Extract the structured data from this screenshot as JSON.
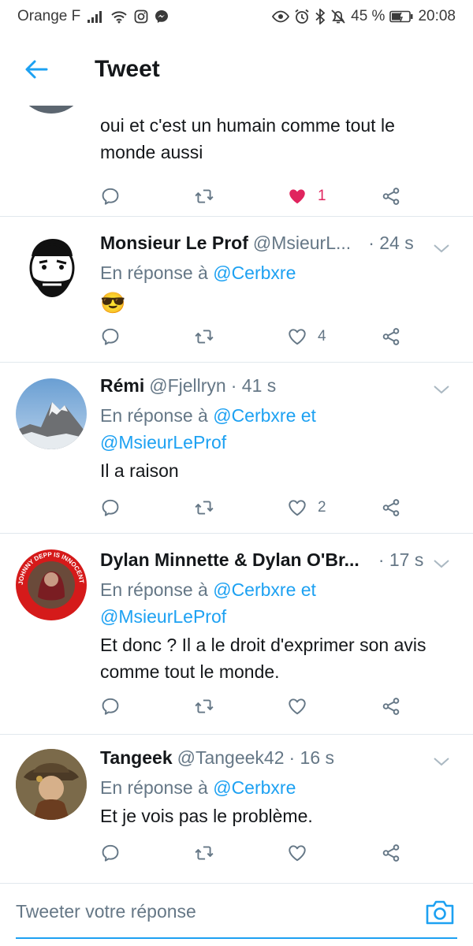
{
  "status_bar": {
    "carrier": "Orange F",
    "battery": "45 %",
    "time": "20:08"
  },
  "header": {
    "title": "Tweet"
  },
  "tweets": [
    {
      "text_line1": "oui et c'est un humain comme tout le",
      "text_line2": "monde aussi",
      "likes": "1",
      "liked": true
    },
    {
      "name": "Monsieur Le Prof",
      "handle": "@MsieurL...",
      "time": "· 24 s",
      "reply_prefix": "En réponse à",
      "reply_to_1": "@Cerbxre",
      "body": "😎",
      "likes": "4"
    },
    {
      "name": "Rémi",
      "handle": "@Fjellryn",
      "time": "· 41 s",
      "reply_prefix": "En réponse à",
      "reply_to_1": "@Cerbxre",
      "reply_join": "et",
      "reply_to_2": "@MsieurLeProf",
      "body": "Il a raison",
      "likes": "2"
    },
    {
      "name": "Dylan Minnette & Dylan O'Br...",
      "time": "· 17 s",
      "reply_prefix": "En réponse à",
      "reply_to_1": "@Cerbxre",
      "reply_join": "et",
      "reply_to_2": "@MsieurLeProf",
      "body_line1": "Et donc ? Il a le droit d'exprimer son avis",
      "body_line2": "comme tout le monde.",
      "avatar_ring_text": "JOHNNY DEPP IS INNOCENT"
    },
    {
      "name": "Tangeek",
      "handle": "@Tangeek42",
      "time": "· 16 s",
      "reply_prefix": "En réponse à",
      "reply_to_1": "@Cerbxre",
      "body": "Et je vois pas le problème."
    }
  ],
  "composer": {
    "placeholder": "Tweeter votre réponse"
  },
  "colors": {
    "accent": "#1da1f2",
    "like": "#e0245e",
    "secondary_text": "#657786",
    "action_icon": "#657786"
  },
  "icons": [
    "back-arrow-icon",
    "chevron-down-icon",
    "reply-icon",
    "retweet-icon",
    "heart-icon",
    "share-icon",
    "camera-icon"
  ]
}
